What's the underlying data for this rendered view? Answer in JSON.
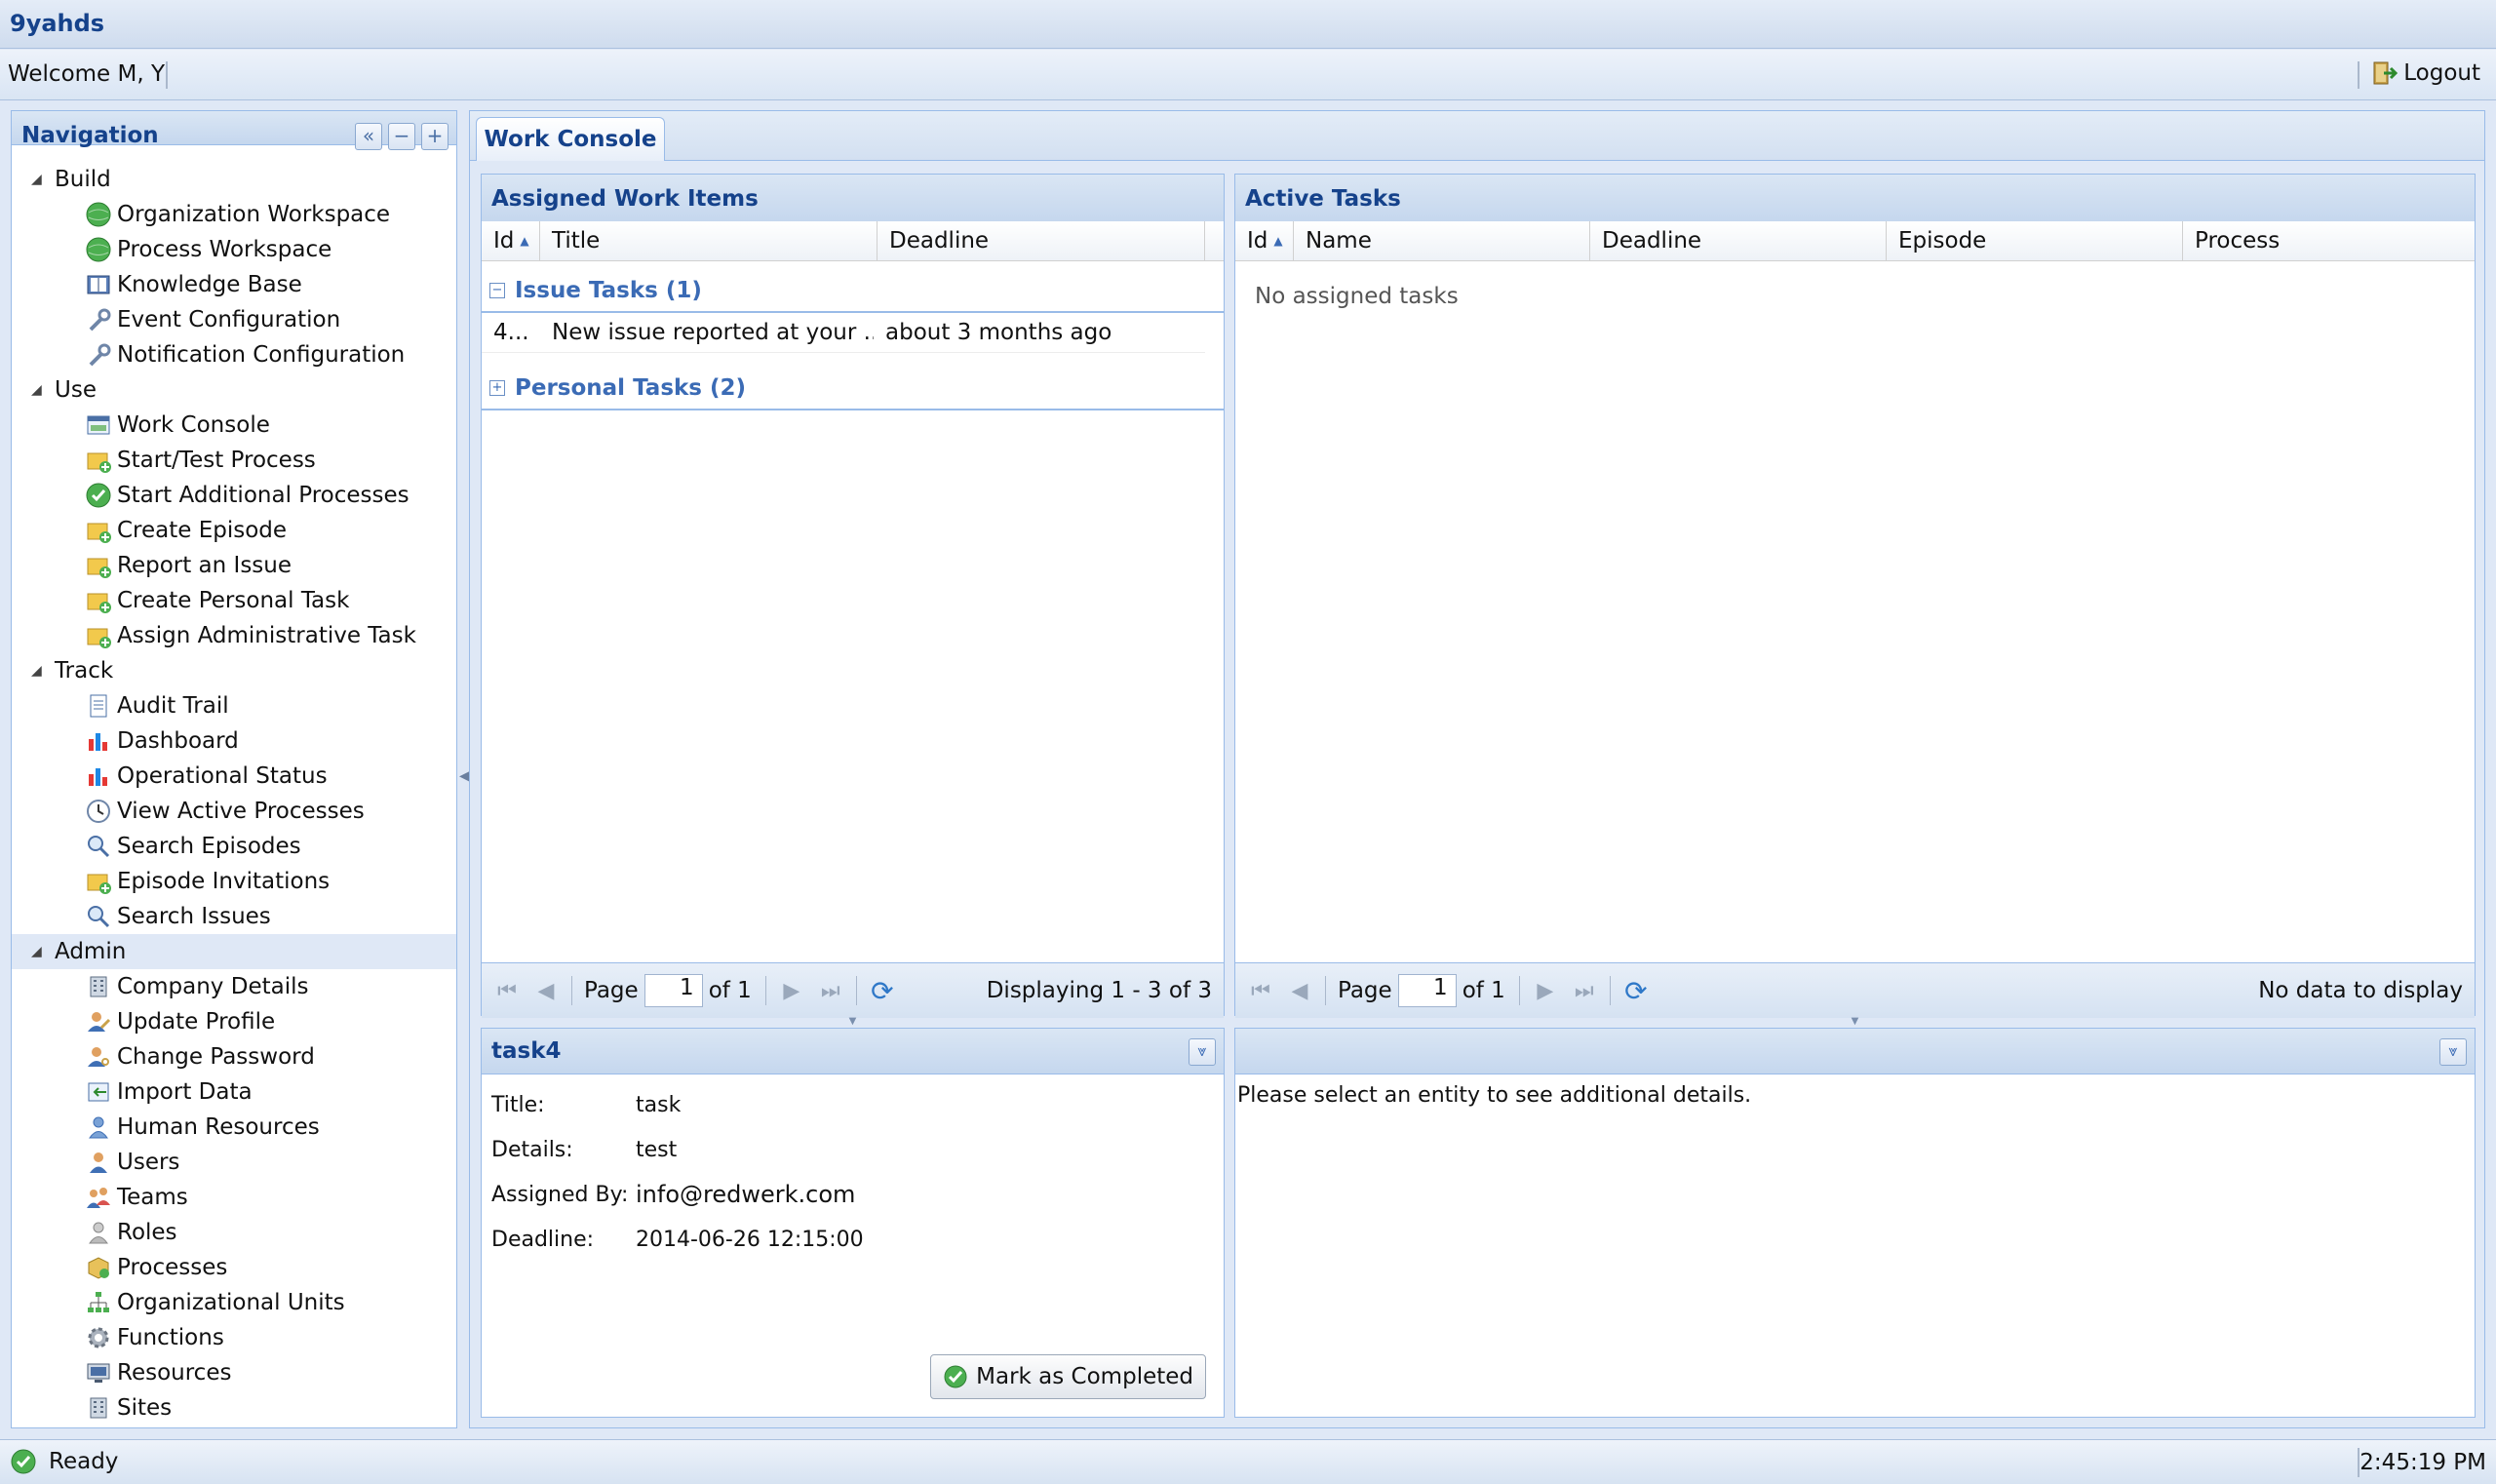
{
  "app": {
    "title": "9yahds"
  },
  "userbar": {
    "welcome": "Welcome M, Y",
    "logout": "Logout"
  },
  "nav": {
    "title": "Navigation",
    "collapse_all": "«",
    "minus": "−",
    "plus": "+",
    "sections": [
      {
        "label": "Build"
      },
      {
        "label": "Use"
      },
      {
        "label": "Track"
      },
      {
        "label": "Admin"
      }
    ],
    "items": {
      "build": [
        {
          "label": "Organization Workspace",
          "icon": "globe-icon"
        },
        {
          "label": "Process Workspace",
          "icon": "globe-icon"
        },
        {
          "label": "Knowledge Base",
          "icon": "book-icon"
        },
        {
          "label": "Event Configuration",
          "icon": "wrench-icon"
        },
        {
          "label": "Notification Configuration",
          "icon": "wrench-icon"
        }
      ],
      "use": [
        {
          "label": "Work Console",
          "icon": "window-icon"
        },
        {
          "label": "Start/Test Process",
          "icon": "folder-add-icon"
        },
        {
          "label": "Start Additional Processes",
          "icon": "check-circle-icon"
        },
        {
          "label": "Create Episode",
          "icon": "folder-add-icon"
        },
        {
          "label": "Report an Issue",
          "icon": "folder-add-icon"
        },
        {
          "label": "Create Personal Task",
          "icon": "folder-add-icon"
        },
        {
          "label": "Assign Administrative Task",
          "icon": "folder-add-icon"
        }
      ],
      "track": [
        {
          "label": "Audit Trail",
          "icon": "document-icon"
        },
        {
          "label": "Dashboard",
          "icon": "bar-chart-icon"
        },
        {
          "label": "Operational Status",
          "icon": "bar-chart-icon"
        },
        {
          "label": "View Active Processes",
          "icon": "clock-icon"
        },
        {
          "label": "Search Episodes",
          "icon": "magnifier-icon"
        },
        {
          "label": "Episode Invitations",
          "icon": "folder-add-icon"
        },
        {
          "label": "Search Issues",
          "icon": "magnifier-icon"
        }
      ],
      "admin": [
        {
          "label": "Company Details",
          "icon": "building-icon"
        },
        {
          "label": "Update Profile",
          "icon": "profile-icon"
        },
        {
          "label": "Change Password",
          "icon": "key-icon"
        },
        {
          "label": "Import Data",
          "icon": "import-icon"
        },
        {
          "label": "Human Resources",
          "icon": "person-icon"
        },
        {
          "label": "Users",
          "icon": "user-icon"
        },
        {
          "label": "Teams",
          "icon": "team-icon"
        },
        {
          "label": "Roles",
          "icon": "role-icon"
        },
        {
          "label": "Processes",
          "icon": "box-icon"
        },
        {
          "label": "Organizational Units",
          "icon": "org-chart-icon"
        },
        {
          "label": "Functions",
          "icon": "gear-icon"
        },
        {
          "label": "Resources",
          "icon": "monitor-icon"
        },
        {
          "label": "Sites",
          "icon": "building-icon"
        }
      ]
    }
  },
  "tabs": [
    {
      "label": "Work Console"
    }
  ],
  "assigned": {
    "title": "Assigned Work Items",
    "columns": [
      "Id",
      "Title",
      "Deadline"
    ],
    "groups": [
      {
        "label": "Issue Tasks (1)",
        "expanded": true
      },
      {
        "label": "Personal Tasks (2)",
        "expanded": false
      }
    ],
    "rows": [
      {
        "id": "4...",
        "title": "New issue reported at your ...",
        "deadline": "about 3 months ago"
      }
    ],
    "pager": {
      "page_label": "Page",
      "page": "1",
      "of": "of 1",
      "display": "Displaying 1 - 3 of 3"
    }
  },
  "active": {
    "title": "Active Tasks",
    "columns": [
      "Id",
      "Name",
      "Deadline",
      "Episode",
      "Process"
    ],
    "empty": "No assigned tasks",
    "pager": {
      "page_label": "Page",
      "page": "1",
      "of": "of 1",
      "display": "No data to display"
    }
  },
  "detail": {
    "title": "task4",
    "fields": [
      {
        "label": "Title:",
        "value": "task"
      },
      {
        "label": "Details:",
        "value": "test"
      },
      {
        "label": "Assigned By:",
        "value": "info@redwerk.com"
      },
      {
        "label": "Deadline:",
        "value": "2014-06-26 12:15:00"
      }
    ],
    "button": "Mark as Completed"
  },
  "detail_right": {
    "message": "Please select an entity to see additional details."
  },
  "status": {
    "ready": "Ready",
    "time": "2:45:19 PM"
  }
}
